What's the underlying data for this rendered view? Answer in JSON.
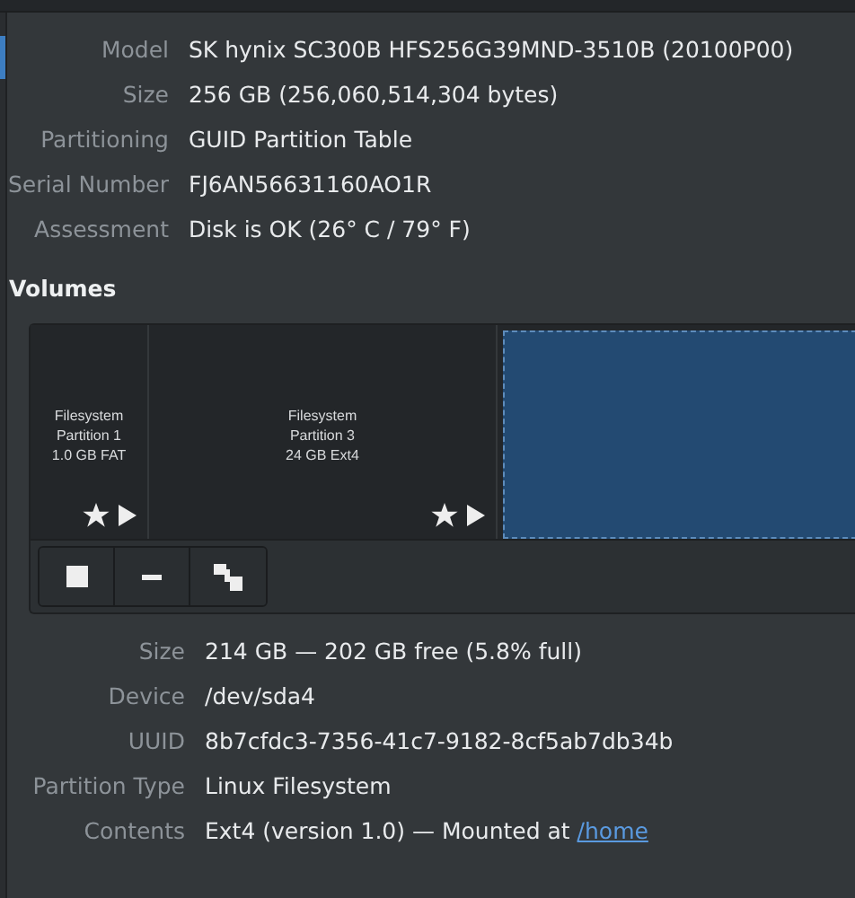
{
  "drive": [
    {
      "label": "Model",
      "value": "SK hynix SC300B HFS256G39MND-3510B (20100P00)"
    },
    {
      "label": "Size",
      "value": "256 GB (256,060,514,304 bytes)"
    },
    {
      "label": "Partitioning",
      "value": "GUID Partition Table"
    },
    {
      "label": "Serial Number",
      "value": "FJ6AN56631160AO1R"
    },
    {
      "label": "Assessment",
      "value": "Disk is OK (26° C / 79° F)"
    }
  ],
  "volumes_heading": "Volumes",
  "volumes": [
    {
      "lines": [
        "Filesystem",
        "Partition 1",
        "1.0 GB FAT"
      ],
      "selected": false
    },
    {
      "lines": [
        "Filesystem",
        "Partition 3",
        "24 GB Ext4"
      ],
      "selected": false
    },
    {
      "selected": true
    }
  ],
  "volume_details": [
    {
      "label": "Size",
      "value": "214 GB — 202 GB free (5.8% full)"
    },
    {
      "label": "Device",
      "value": "/dev/sda4"
    },
    {
      "label": "UUID",
      "value": "8b7cfdc3-7356-41c7-9182-8cf5ab7db34b"
    },
    {
      "label": "Partition Type",
      "value": "Linux Filesystem"
    },
    {
      "label": "Contents",
      "value": "Ext4 (version 1.0) — Mounted at",
      "link": "/home"
    }
  ]
}
